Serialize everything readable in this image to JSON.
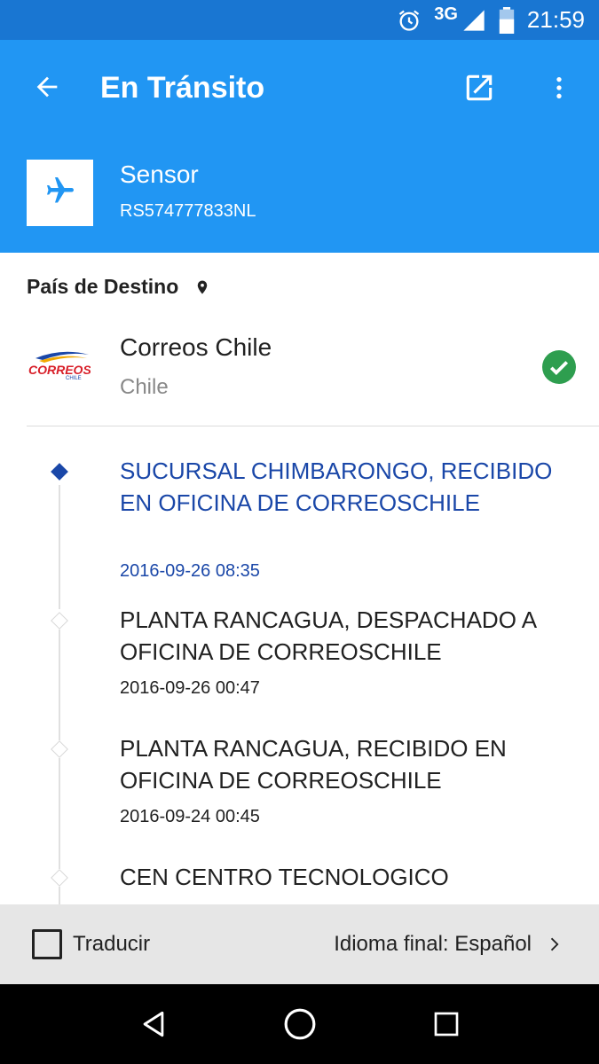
{
  "status_bar": {
    "network": "3G",
    "time": "21:59",
    "icons": [
      "alarm-icon",
      "signal-icon",
      "battery-icon"
    ]
  },
  "app_bar": {
    "title": "En Tránsito",
    "back_icon": "arrow-back-icon",
    "open_external_icon": "open-in-new-icon",
    "more_icon": "more-vert-icon"
  },
  "package": {
    "name": "Sensor",
    "tracking_code": "RS574777833NL",
    "icon": "airplane-icon"
  },
  "destination": {
    "header": "País de Destino",
    "carrier_name": "Correos Chile",
    "country": "Chile",
    "logo_text": "CORREOS",
    "logo_subtext": "CHILE"
  },
  "events": [
    {
      "text": "SUCURSAL CHIMBARONGO, RECIBIDO EN OFICINA DE CORREOSCHILE",
      "date": "2016-09-26 08:35",
      "active": true
    },
    {
      "text": "PLANTA RANCAGUA, DESPACHADO A OFICINA DE CORREOSCHILE",
      "date": "2016-09-26 00:47",
      "active": false
    },
    {
      "text": "PLANTA RANCAGUA, RECIBIDO EN OFICINA DE CORREOSCHILE",
      "date": "2016-09-24 00:45",
      "active": false
    },
    {
      "text": "CEN CENTRO TECNOLOGICO",
      "date": "",
      "active": false
    }
  ],
  "translate": {
    "checkbox_label": "Traducir",
    "target_language": "Idioma final: Español"
  },
  "colors": {
    "status_bar": "#1976d2",
    "app_bar": "#2196f3",
    "active_event": "#1a47a8",
    "check": "#2e9e4f"
  }
}
